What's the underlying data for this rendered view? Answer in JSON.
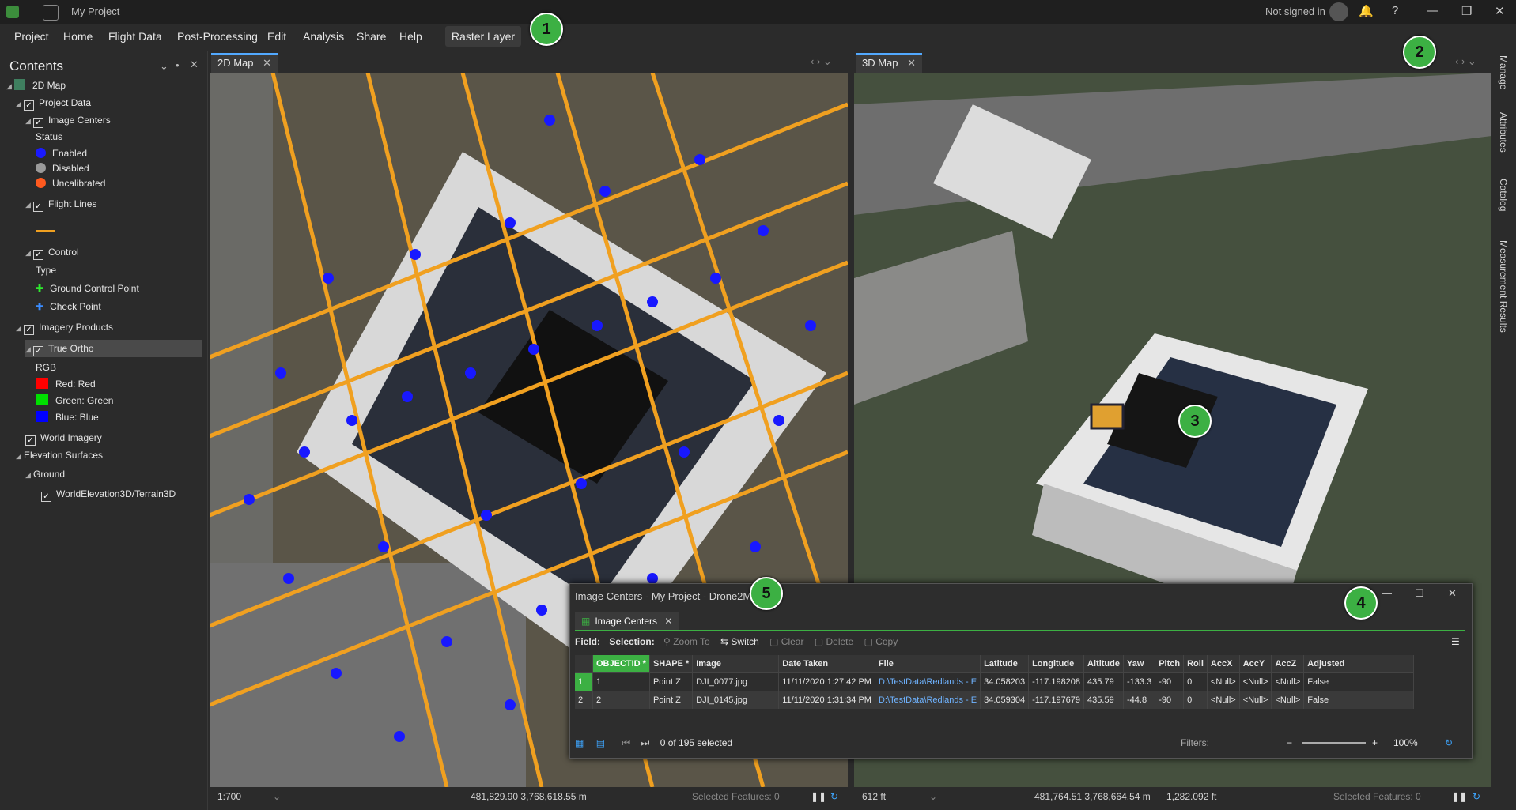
{
  "app": {
    "title": "My Project",
    "signed_in": "Not signed in"
  },
  "menu": {
    "items": [
      "Project",
      "Home",
      "Flight Data",
      "Post-Processing",
      "Edit",
      "Analysis",
      "Share",
      "Help"
    ],
    "raster_tab": "Raster Layer"
  },
  "callouts": [
    "1",
    "2",
    "3",
    "4",
    "5"
  ],
  "contents": {
    "title": "Contents",
    "map": "2D Map",
    "project_data": "Project Data",
    "image_centers": "Image Centers",
    "status": "Status",
    "legend": [
      {
        "label": "Enabled",
        "color": "#1a1aff"
      },
      {
        "label": "Disabled",
        "color": "#9a9a9a"
      },
      {
        "label": "Uncalibrated",
        "color": "#ff5a1f"
      }
    ],
    "flight_lines": "Flight Lines",
    "flight_line_color": "#f0a020",
    "control": "Control",
    "type": "Type",
    "gcp": "Ground Control Point",
    "checkpoint": "Check Point",
    "imagery_products": "Imagery Products",
    "true_ortho": "True Ortho",
    "rgb": "RGB",
    "bands": [
      {
        "label": "Red:  Red",
        "color": "#ff0000"
      },
      {
        "label": "Green: Green",
        "color": "#00e000"
      },
      {
        "label": "Blue:  Blue",
        "color": "#0000ff"
      }
    ],
    "world_imagery": "World Imagery",
    "elevation": "Elevation Surfaces",
    "ground": "Ground",
    "terrain": "WorldElevation3D/Terrain3D"
  },
  "views": {
    "map2d_tab": "2D Map",
    "map3d_tab": "3D Map",
    "status2d": {
      "scale": "1:700",
      "coords": "481,829.90 3,768,618.55 m",
      "selected": "Selected Features: 0"
    },
    "status3d": {
      "scale": "612 ft",
      "coords": "481,764.51 3,768,664.54 m",
      "elev": "1,282.092 ft",
      "selected": "Selected Features: 0"
    }
  },
  "rightdock": [
    "Manage",
    "Attributes",
    "Catalog",
    "Measurement Results"
  ],
  "attribute_table": {
    "window_title": "Image Centers - My Project - Drone2Map",
    "tab": "Image Centers",
    "toolbar": {
      "field": "Field:",
      "selection": "Selection:",
      "zoom": "Zoom To",
      "switch": "Switch",
      "clear": "Clear",
      "delete": "Delete",
      "copy": "Copy"
    },
    "columns": [
      "OBJECTID *",
      "SHAPE *",
      "Image",
      "Date Taken",
      "File",
      "Latitude",
      "Longitude",
      "Altitude",
      "Yaw",
      "Pitch",
      "Roll",
      "AccX",
      "AccY",
      "AccZ",
      "Adjusted"
    ],
    "rows": [
      [
        "1",
        "1",
        "Point Z",
        "DJI_0077.jpg",
        "11/11/2020 1:27:42 PM",
        "D:\\TestData\\Redlands - E",
        "34.058203",
        "-117.198208",
        "435.79",
        "-133.3",
        "-90",
        "0",
        "<Null>",
        "<Null>",
        "<Null>",
        "False"
      ],
      [
        "2",
        "2",
        "Point Z",
        "DJI_0145.jpg",
        "11/11/2020 1:31:34 PM",
        "D:\\TestData\\Redlands - E",
        "34.059304",
        "-117.197679",
        "435.59",
        "-44.8",
        "-90",
        "0",
        "<Null>",
        "<Null>",
        "<Null>",
        "False"
      ]
    ],
    "selected_count": "0 of 195 selected",
    "filters": "Filters:",
    "zoom": "100%"
  }
}
